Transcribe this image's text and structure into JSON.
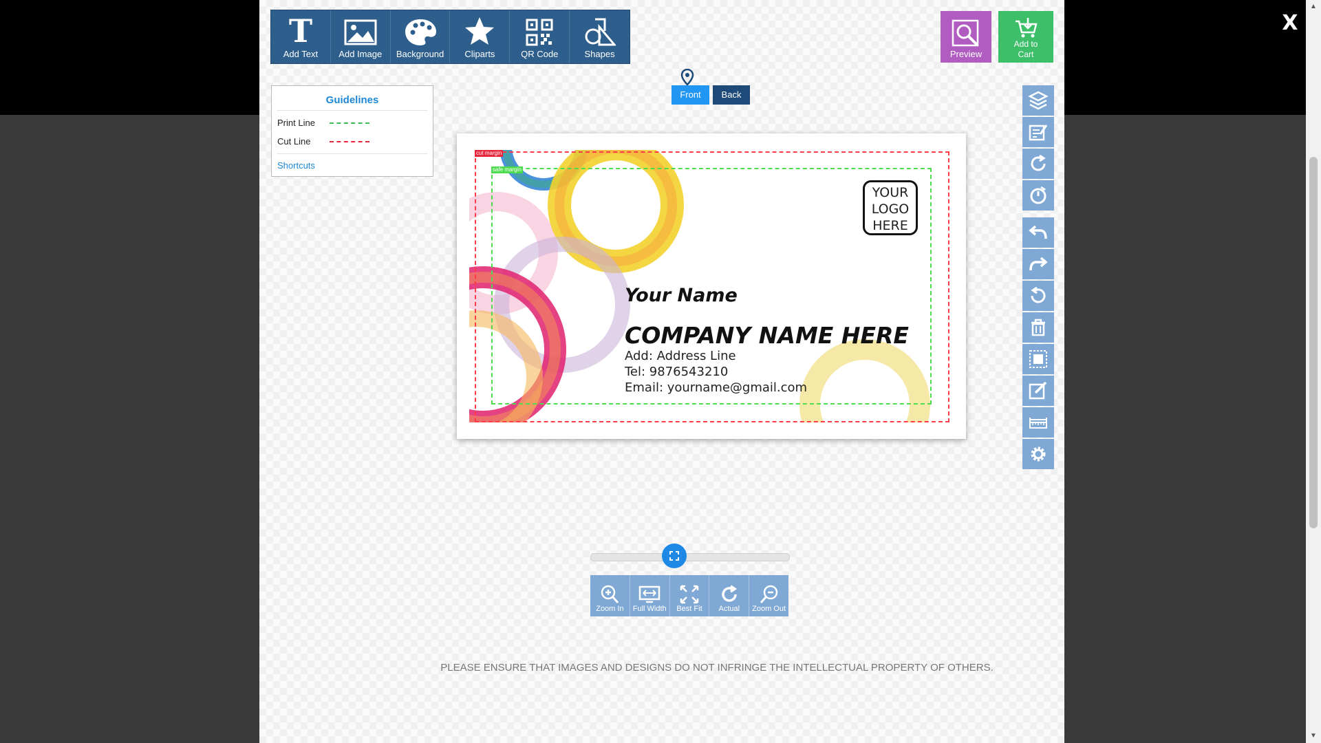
{
  "window": {
    "close_label": "X"
  },
  "toolbar": {
    "items": [
      {
        "label": "Add Text",
        "icon": "text-icon"
      },
      {
        "label": "Add Image",
        "icon": "image-icon"
      },
      {
        "label": "Background",
        "icon": "palette-icon"
      },
      {
        "label": "Cliparts",
        "icon": "star-icon"
      },
      {
        "label": "QR Code",
        "icon": "qr-code-icon"
      },
      {
        "label": "Shapes",
        "icon": "shapes-icon"
      }
    ]
  },
  "actions": {
    "preview_label": "Preview",
    "cart_label_line1": "Add to",
    "cart_label_line2": "Cart"
  },
  "guidelines": {
    "title": "Guidelines",
    "print_line": "Print Line",
    "cut_line": "Cut Line",
    "shortcuts": "Shortcuts",
    "print_color": "#3cba54",
    "cut_color": "#e8263b"
  },
  "sides": {
    "front": "Front",
    "back": "Back",
    "active": "Front"
  },
  "card": {
    "cut_margin_tag": "cut margin",
    "safe_margin_tag": "safe margin",
    "logo_line1": "YOUR",
    "logo_line2": "LOGO",
    "logo_line3": "HERE",
    "name": "Your Name",
    "company": "COMPANY NAME HERE",
    "address": "Add: Address Line",
    "tel": "Tel: 9876543210",
    "email": "Email: yourname@gmail.com"
  },
  "right_tools": [
    "layers-icon",
    "edit-note-icon",
    "rotate-icon",
    "rotate-circle-icon",
    "undo-icon",
    "redo-icon",
    "reset-icon",
    "trash-icon",
    "select-all-icon",
    "edit-icon",
    "ruler-icon",
    "settings-icon"
  ],
  "zoom": {
    "level_fraction": 0.42,
    "buttons": [
      "Zoom In",
      "Full Width",
      "Best Fit",
      "Actual",
      "Zoom Out"
    ]
  },
  "disclaimer": "PLEASE ENSURE THAT IMAGES AND DESIGNS DO NOT INFRINGE THE INTELLECTUAL PROPERTY OF OTHERS."
}
